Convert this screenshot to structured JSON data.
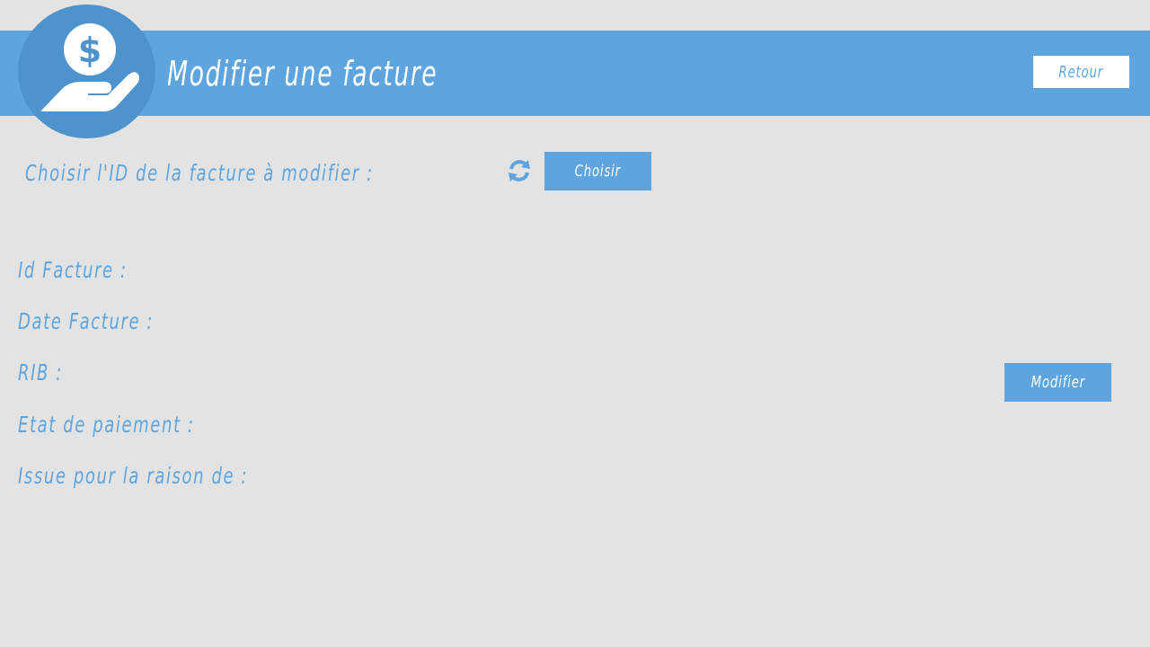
{
  "header": {
    "title": "Modifier une facture",
    "back_label": "Retour",
    "logo_icon": "hand-dollar-icon"
  },
  "selector": {
    "label": "Choisir l'ID de la facture à modifier :",
    "refresh_icon": "refresh-icon",
    "choose_label": "Choisir"
  },
  "fields": [
    {
      "label": "Id Facture :"
    },
    {
      "label": "Date Facture :"
    },
    {
      "label": "RIB :"
    },
    {
      "label": "Etat de paiement :"
    },
    {
      "label": "Issue pour la raison de :"
    }
  ],
  "actions": {
    "modify_label": "Modifier"
  },
  "colors": {
    "background": "#e3e3e3",
    "accent": "#5ea4df",
    "logo_circle": "#4f93cc",
    "white": "#ffffff"
  }
}
